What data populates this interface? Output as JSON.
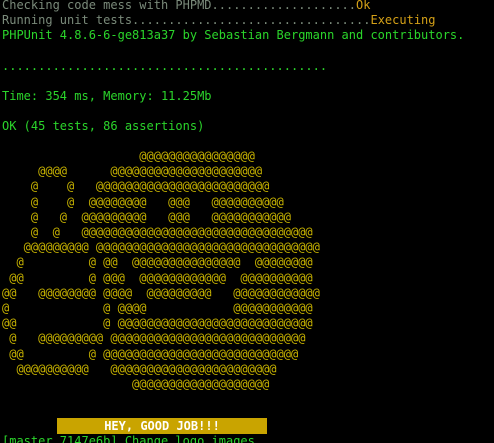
{
  "lines": {
    "phpmd_label": "Checking code mess with PHPMD",
    "phpmd_dots": "....................",
    "phpmd_status": "Ok",
    "unit_label": "Running unit tests",
    "unit_dots": ".................................",
    "unit_status": "Executing",
    "phpunit_version": "PHPUnit 4.8.6-6-ge813a37 by Sebastian Bergmann and contributors.",
    "progress_dots": ".............................................",
    "time_memory": "Time: 354 ms, Memory: 11.25Mb",
    "result": "OK (45 tests, 86 assertions)"
  },
  "ascii_art": "                   @@@@@@@@@@@@@@@@\n     @@@@      @@@@@@@@@@@@@@@@@@@@@\n    @    @   @@@@@@@@@@@@@@@@@@@@@@@@\n    @    @  @@@@@@@@   @@@   @@@@@@@@@@\n    @   @  @@@@@@@@@   @@@   @@@@@@@@@@@\n    @  @   @@@@@@@@@@@@@@@@@@@@@@@@@@@@@@@@\n   @@@@@@@@@ @@@@@@@@@@@@@@@@@@@@@@@@@@@@@@@\n  @         @ @@  @@@@@@@@@@@@@@@  @@@@@@@@\n @@         @ @@@  @@@@@@@@@@@@  @@@@@@@@@@\n@@   @@@@@@@@ @@@@  @@@@@@@@@   @@@@@@@@@@@@\n@             @ @@@@            @@@@@@@@@@@\n@@            @ @@@@@@@@@@@@@@@@@@@@@@@@@@@\n @   @@@@@@@@@ @@@@@@@@@@@@@@@@@@@@@@@@@@@\n @@         @ @@@@@@@@@@@@@@@@@@@@@@@@@@@\n  @@@@@@@@@@   @@@@@@@@@@@@@@@@@@@@@@@\n                  @@@@@@@@@@@@@@@@@@@",
  "banner": "HEY, GOOD JOB!!!",
  "status_line": "[master 7147e6b] Change logo images",
  "colors": {
    "background": "#000000",
    "text_green": "#2bd52b",
    "text_dim": "#7a8a7a",
    "status_orange": "#d4a017",
    "art_yellow": "#c9b400",
    "banner_bg": "#c9a400",
    "banner_fg": "#ffffff"
  }
}
